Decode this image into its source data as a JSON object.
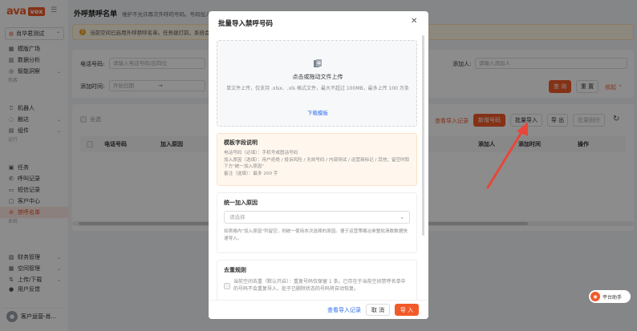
{
  "brand": {
    "logo_text": "ava",
    "logo_badge": "vox",
    "accent": "#f15a29"
  },
  "workspace": {
    "name": "肖华君测试"
  },
  "sidebar": {
    "items": [
      {
        "label": "模版广场",
        "icon": "grid-icon"
      },
      {
        "label": "数据分析",
        "icon": "chart-icon"
      },
      {
        "label": "智能洞察",
        "icon": "bulb-icon"
      }
    ],
    "group1": "拓客",
    "items2": [
      {
        "label": "机器人",
        "icon": "robot-icon"
      },
      {
        "label": "触达",
        "icon": "send-icon"
      },
      {
        "label": "组件",
        "icon": "component-icon"
      }
    ],
    "group2": "运行",
    "items3": [
      {
        "label": "任务",
        "icon": "task-icon"
      },
      {
        "label": "呼叫记录",
        "icon": "phone-icon"
      },
      {
        "label": "短信记录",
        "icon": "sms-icon"
      },
      {
        "label": "客户中心",
        "icon": "customer-icon"
      },
      {
        "label": "禁呼名单",
        "icon": "block-icon"
      }
    ],
    "group3": "系统",
    "items4": [
      {
        "label": "财务管理",
        "icon": "finance-icon"
      },
      {
        "label": "空间管理",
        "icon": "space-icon"
      },
      {
        "label": "上传/下载",
        "icon": "upload-icon"
      },
      {
        "label": "用户反馈",
        "icon": "feedback-icon"
      }
    ],
    "user": "客户运营-肖..."
  },
  "header": {
    "title": "外呼禁呼名单",
    "desc": "维护不允许再次外呼的号码。号码加入后，"
  },
  "notice": {
    "text": "当前空间已启用外呼禁呼名单。任务拨打前，系统会"
  },
  "filters": {
    "phone_label": "电话号码:",
    "phone_placeholder": "请输入电话号码/后四位",
    "added_by_label": "添加人:",
    "added_by_placeholder": "请输入添加人",
    "time_label": "添加时间:",
    "start_placeholder": "开始日期",
    "end_placeholder": "结束日期",
    "query": "查 询",
    "reset": "重 置",
    "collapse": "收起"
  },
  "toolbar": {
    "select_all": "全选",
    "view_import_log": "查看导入记录",
    "add_number": "新增号码",
    "batch_import": "批量导入",
    "export": "导 出",
    "batch_delete": "批量删除"
  },
  "table": {
    "columns": [
      "电话号码",
      "加入原因",
      "添加人",
      "添加时间",
      "操作"
    ]
  },
  "modal": {
    "title": "批量导入禁呼号码",
    "upload_title": "点击或拖动文件上传",
    "upload_hint": "单文件上传，仅支持 .xlsx、.xls 格式文件，最大不超过 100MB，最多上传 100 万条",
    "download_template": "下载模板",
    "template_title": "模板字段说明",
    "template_lines": [
      "电话号码（必填）：手机号或固话号码",
      "加入原因（选填）：用户拒绝 / 投诉风险 / 无效号码 / 内部测试 / 运营商标记 / 其他；留空时取",
      "下方\"统一加入原因\"",
      "备注（选填）：最多 200 字"
    ],
    "reason_title": "统一加入原因",
    "reason_placeholder": "请选择",
    "reason_hint": "如表格内\"加入原因\"列留空，则统一使用本次选择的原因。便于运营策略冶单整批清数数据快速导入。",
    "dedupe_title": "去重规则",
    "dedupe_text": "当前空间去重（默认开启）：重复号码仅保留 1 条。已存在于当前空间禁呼名单中的号码不会重复导入，处于已删除状态的号码将自动恢复。",
    "foot_link": "查看导入记录",
    "cancel": "取 消",
    "ok": "导 入"
  },
  "helper": {
    "label": "平台助手"
  }
}
